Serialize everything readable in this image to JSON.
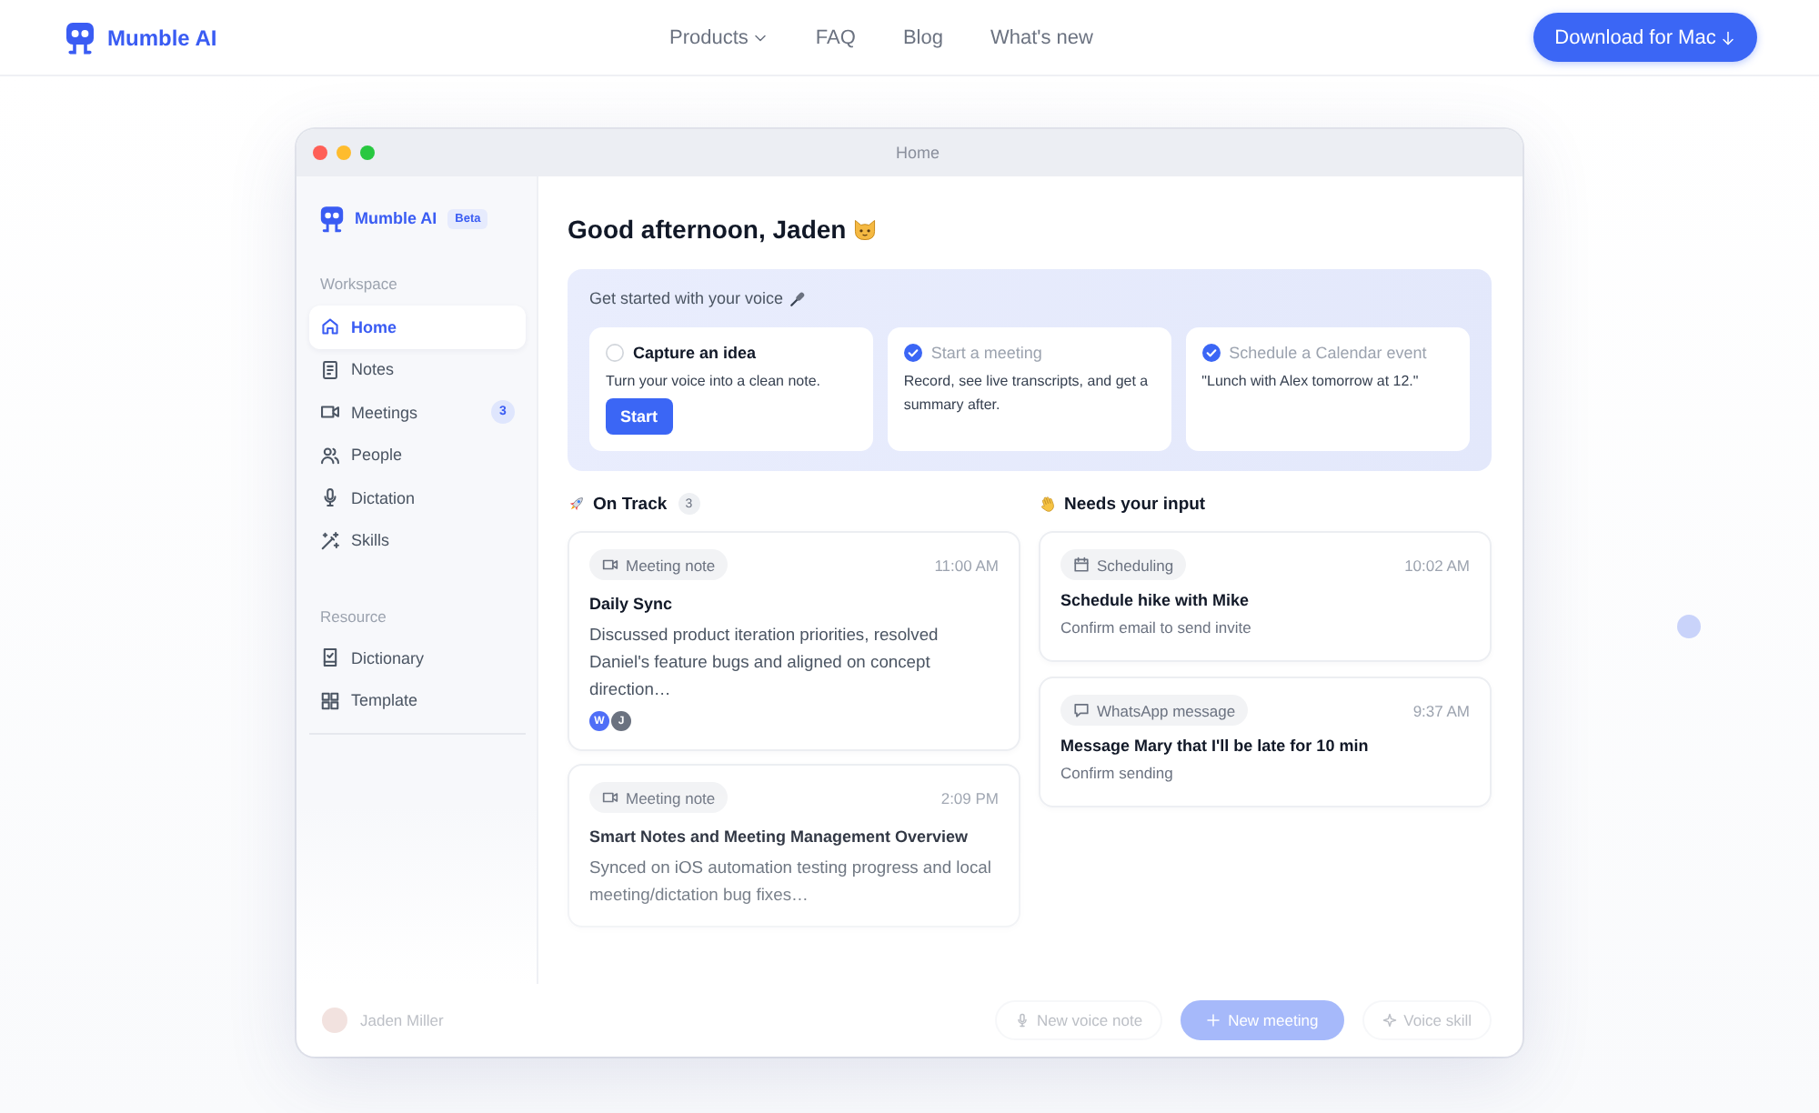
{
  "nav": {
    "brand": "Mumble AI",
    "links": [
      {
        "label": "Products",
        "dropdown": true
      },
      {
        "label": "FAQ",
        "dropdown": false
      },
      {
        "label": "Blog",
        "dropdown": false
      },
      {
        "label": "What's new",
        "dropdown": false
      }
    ],
    "download_button": "Download for Mac"
  },
  "window": {
    "title": "Home"
  },
  "sidebar": {
    "brand": "Mumble AI",
    "badge": "Beta",
    "sections": [
      {
        "heading": "Workspace",
        "items": [
          {
            "label": "Home",
            "selected": true
          },
          {
            "label": "Notes",
            "selected": false
          },
          {
            "label": "Meetings",
            "selected": false,
            "count": "3"
          },
          {
            "label": "People",
            "selected": false
          },
          {
            "label": "Dictation",
            "selected": false
          },
          {
            "label": "Skills",
            "selected": false
          }
        ]
      },
      {
        "heading": "Resource",
        "items": [
          {
            "label": "Dictionary",
            "selected": false
          },
          {
            "label": "Template",
            "selected": false
          }
        ]
      }
    ]
  },
  "greeting": "Good afternoon, Jaden",
  "get_started": {
    "title": "Get started with your voice",
    "tasks": [
      {
        "title": "Capture an idea",
        "done": false,
        "description": "Turn your voice into a clean note.",
        "button": "Start"
      },
      {
        "title": "Start a meeting",
        "done": true,
        "description": "Record, see live transcripts, and get a summary after."
      },
      {
        "title": "Schedule a Calendar event",
        "done": true,
        "description": "\"Lunch with Alex tomorrow at 12.\""
      }
    ]
  },
  "on_track": {
    "title": "On Track",
    "count": "3",
    "cards": [
      {
        "kind": "meeting",
        "tag": "Meeting note",
        "time": "11:00 AM",
        "title": "Daily Sync",
        "description": "Discussed product iteration priorities, resolved Daniel's feature bugs and aligned on concept direction…",
        "participants": [
          {
            "initial": "W",
            "color": "#4f6ef7"
          },
          {
            "initial": "J",
            "color": "#6b7280"
          }
        ]
      },
      {
        "kind": "meeting",
        "tag": "Meeting note",
        "time": "2:09 PM",
        "title": "Smart Notes and Meeting Management Overview",
        "description": "Synced on iOS automation testing progress and local meeting/dictation bug fixes…"
      }
    ]
  },
  "needs_input": {
    "title": "Needs your input",
    "cards": [
      {
        "kind": "scheduling",
        "tag": "Scheduling",
        "time": "10:02 AM",
        "title": "Schedule hike with Mike",
        "description": "Confirm email to send invite"
      },
      {
        "kind": "message",
        "tag": "WhatsApp message",
        "time": "9:37 AM",
        "title": "Message Mary that I'll be late for 10 min",
        "description": "Confirm sending"
      }
    ]
  },
  "footer": {
    "user": "Jaden Miller",
    "actions": [
      {
        "kind": "voice_note",
        "label": "New voice note",
        "primary": false
      },
      {
        "kind": "meeting",
        "label": "New meeting",
        "primary": true
      },
      {
        "kind": "skill",
        "label": "Voice skill",
        "primary": false
      }
    ]
  }
}
